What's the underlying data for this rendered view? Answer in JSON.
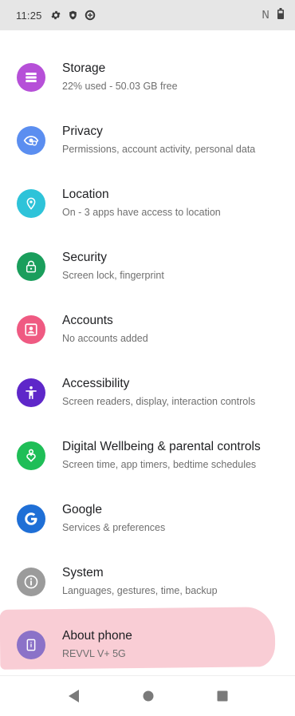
{
  "status_bar": {
    "time": "11:25",
    "left_icons": [
      "gear-icon",
      "shield-icon",
      "data-saver-icon"
    ],
    "right_icons": [
      "nfc-icon",
      "battery-icon"
    ],
    "nfc_glyph": "N",
    "background": "#e6e6e6"
  },
  "settings": [
    {
      "title": "Storage",
      "summary": "22% used - 50.03 GB free",
      "icon": "storage-icon",
      "color": "#b650d8"
    },
    {
      "title": "Privacy",
      "summary": "Permissions, account activity, personal data",
      "icon": "privacy-icon",
      "color": "#5b8ef0"
    },
    {
      "title": "Location",
      "summary": "On - 3 apps have access to location",
      "icon": "location-icon",
      "color": "#2ec3d9"
    },
    {
      "title": "Security",
      "summary": "Screen lock, fingerprint",
      "icon": "lock-icon",
      "color": "#1a9e5c"
    },
    {
      "title": "Accounts",
      "summary": "No accounts added",
      "icon": "accounts-icon",
      "color": "#ef5a82"
    },
    {
      "title": "Accessibility",
      "summary": "Screen readers, display, interaction controls",
      "icon": "accessibility-icon",
      "color": "#5e27c9"
    },
    {
      "title": "Digital Wellbeing & parental controls",
      "summary": "Screen time, app timers, bedtime schedules",
      "icon": "wellbeing-icon",
      "color": "#1fbe57"
    },
    {
      "title": "Google",
      "summary": "Services & preferences",
      "icon": "google-icon",
      "color": "#1f6fd6"
    },
    {
      "title": "System",
      "summary": "Languages, gestures, time, backup",
      "icon": "info-icon",
      "color": "#9b9b9b"
    },
    {
      "title": "About phone",
      "summary": "REVVL V+ 5G",
      "icon": "phone-icon",
      "color": "#8b72c8"
    }
  ],
  "nav": {
    "buttons": [
      "back-icon",
      "home-icon",
      "recents-icon"
    ],
    "color": "#7a7a7a"
  },
  "highlight_color": "#f4a4b2"
}
